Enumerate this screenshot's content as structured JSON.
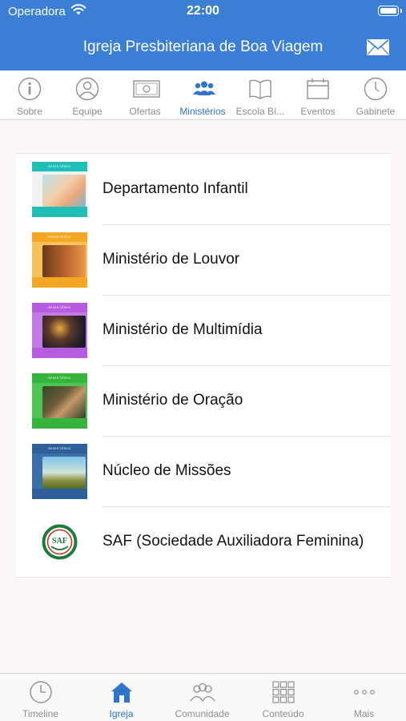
{
  "status_bar": {
    "carrier": "Operadora",
    "time": "22:00"
  },
  "header": {
    "title": "Igreja Presbiteriana de Boa Viagem",
    "mail_icon": "envelope-icon"
  },
  "top_tabs": [
    {
      "label": "Sobre",
      "icon": "info-icon",
      "active": false
    },
    {
      "label": "Equipe",
      "icon": "person-icon",
      "active": false
    },
    {
      "label": "Ofertas",
      "icon": "banknote-icon",
      "active": false
    },
    {
      "label": "Ministérios",
      "icon": "group-icon",
      "active": true
    },
    {
      "label": "Escola Bí...",
      "icon": "book-icon",
      "active": false
    },
    {
      "label": "Eventos",
      "icon": "calendar-icon",
      "active": false
    },
    {
      "label": "Gabinete",
      "icon": "clock-icon",
      "active": false
    }
  ],
  "ministries": [
    {
      "label": "Departamento Infantil",
      "thumb_icon": "child-photo-thumbnail",
      "color": "#1fbfb7"
    },
    {
      "label": "Ministério de Louvor",
      "thumb_icon": "guitar-photo-thumbnail",
      "color": "#f5a623"
    },
    {
      "label": "Ministério de Multimídia",
      "thumb_icon": "camera-photo-thumbnail",
      "color": "#b75be0"
    },
    {
      "label": "Ministério de Oração",
      "thumb_icon": "prayer-photo-thumbnail",
      "color": "#35b53a"
    },
    {
      "label": "Núcleo de Missões",
      "thumb_icon": "landscape-photo-thumbnail",
      "color": "#2d5f9a"
    },
    {
      "label": "SAF (Sociedade Auxiliadora Feminina)",
      "thumb_icon": "saf-logo",
      "color": "#1e7a3a",
      "logo_text": "SAF"
    }
  ],
  "thumb_band_text": "MINISTÉRIO",
  "bottom_tabs": [
    {
      "label": "Timeline",
      "icon": "clock-icon",
      "active": false
    },
    {
      "label": "Igreja",
      "icon": "house-icon",
      "active": true
    },
    {
      "label": "Comunidade",
      "icon": "people-icon",
      "active": false
    },
    {
      "label": "Conteúdo",
      "icon": "grid-icon",
      "active": false
    },
    {
      "label": "Mais",
      "icon": "ellipsis-icon",
      "active": false
    }
  ],
  "colors": {
    "brand": "#3a7fd5",
    "active_tab": "#2f74c8",
    "inactive_tab": "#8e8e93",
    "background": "#fdf6f6"
  }
}
